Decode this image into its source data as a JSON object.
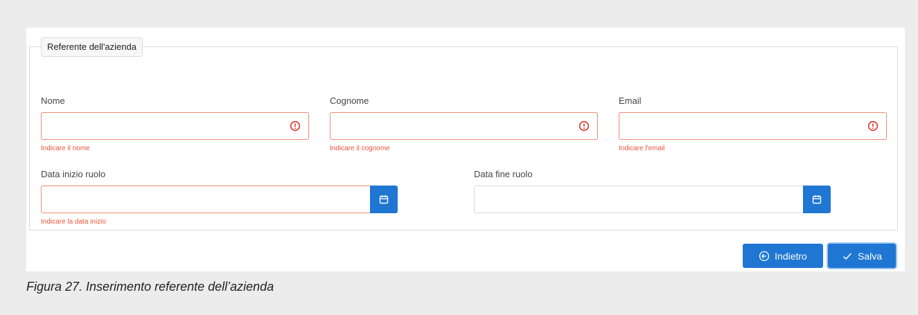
{
  "section": {
    "legend": "Referente dell'azienda"
  },
  "fields": {
    "nome": {
      "label": "Nome",
      "value": "",
      "error": "Indicare il nome"
    },
    "cognome": {
      "label": "Cognome",
      "value": "",
      "error": "Indicare il cognome"
    },
    "email": {
      "label": "Email",
      "value": "",
      "error": "Indicare l'email"
    },
    "data_inizio": {
      "label": "Data inizio ruolo",
      "value": "",
      "error": "Indicare la data inizio"
    },
    "data_fine": {
      "label": "Data fine ruolo",
      "value": ""
    }
  },
  "actions": {
    "back_label": "Indietro",
    "save_label": "Salva"
  },
  "caption": "Figura 27. Inserimento referente dell’azienda",
  "icons": {
    "error": "error-circle-icon",
    "calendar": "calendar-icon",
    "back": "arrow-left-circle-icon",
    "save": "check-icon"
  },
  "colors": {
    "primary": "#1f76d3",
    "error": "#e8553a",
    "invalid_border": "#f08a6e"
  }
}
